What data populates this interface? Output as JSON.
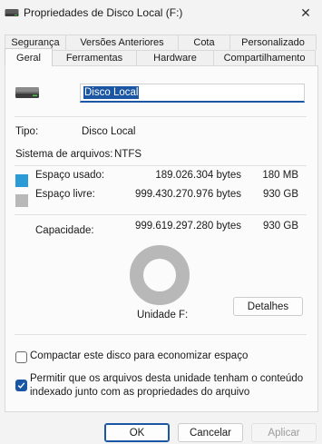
{
  "window": {
    "title": "Propriedades de Disco Local  (F:)",
    "close_glyph": "✕"
  },
  "tabs_row1": [
    {
      "label": "Segurança"
    },
    {
      "label": "Versões Anteriores"
    },
    {
      "label": "Cota"
    },
    {
      "label": "Personalizado"
    }
  ],
  "tabs_row2": [
    {
      "label": "Geral",
      "active": true
    },
    {
      "label": "Ferramentas"
    },
    {
      "label": "Hardware"
    },
    {
      "label": "Compartilhamento"
    }
  ],
  "general": {
    "drive_name": "Disco Local",
    "type_label": "Tipo:",
    "type_value": "Disco Local",
    "fs_label": "Sistema de arquivos:",
    "fs_value": "NTFS",
    "used_label": "Espaço usado:",
    "used_bytes": "189.026.304 bytes",
    "used_size": "180 MB",
    "free_label": "Espaço livre:",
    "free_bytes": "999.430.270.976 bytes",
    "free_size": "930 GB",
    "capacity_label": "Capacidade:",
    "capacity_bytes": "999.619.297.280 bytes",
    "capacity_size": "930 GB",
    "drive_label": "Unidade F:",
    "details_button": "Detalhes",
    "compress_label": "Compactar este disco para economizar espaço",
    "compress_checked": false,
    "index_label_line1": "Permitir que os arquivos desta unidade tenham o conteúdo",
    "index_label_line2": "indexado junto com as propriedades do arquivo",
    "index_checked": true,
    "used_fraction": 0.0002
  },
  "colors": {
    "used": "#2b9bd8",
    "free": "#b8b8b8",
    "accent": "#1a56a4"
  },
  "buttons": {
    "ok": "OK",
    "cancel": "Cancelar",
    "apply": "Aplicar"
  },
  "icons": {
    "title": "drive-icon",
    "drive": "hard-drive-icon",
    "close": "close-icon",
    "check": "checkmark-icon"
  }
}
